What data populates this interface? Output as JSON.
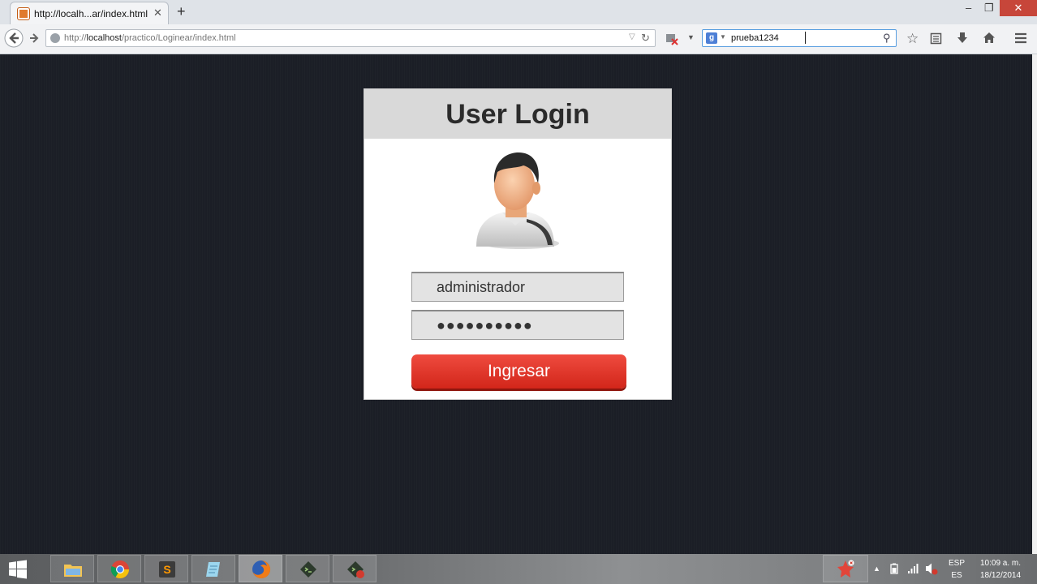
{
  "browser": {
    "tab_title": "http://localh...ar/index.html",
    "url_prefix": "http://",
    "url_host": "localhost",
    "url_path": "/practico/Loginear/index.html",
    "search_value": "prueba1234"
  },
  "login": {
    "title": "User Login",
    "username_value": "administrador",
    "password_mask": "●●●●●●●●●●",
    "submit_label": "Ingresar"
  },
  "taskbar": {
    "lang_top": "ESP",
    "lang_bottom": "ES",
    "time": "10:09 a. m.",
    "date": "18/12/2014",
    "apps": [
      "file-explorer",
      "chrome",
      "sublime-text",
      "notepad",
      "firefox",
      "terminal-app",
      "terminal-app-2"
    ]
  },
  "colors": {
    "page_bg": "#1b1e26",
    "button_red": "#e03528",
    "header_gray": "#d9d9d9"
  }
}
